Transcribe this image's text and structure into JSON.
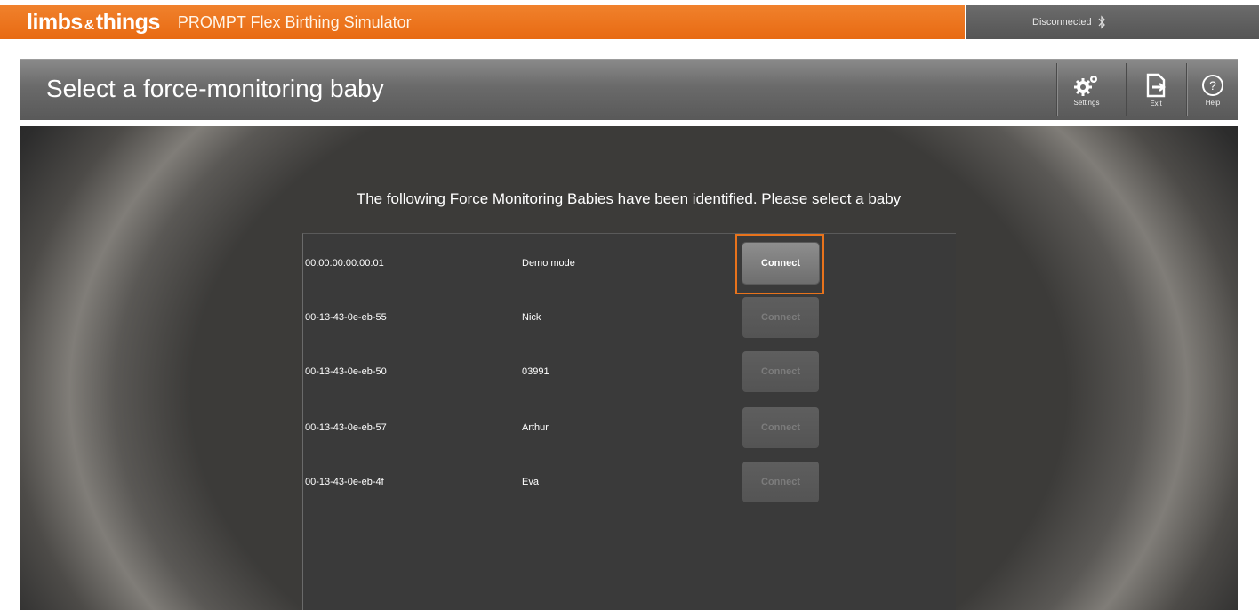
{
  "app": {
    "brand": "limbs&things",
    "brand_main_a": "limbs",
    "brand_amp": "&",
    "brand_main_b": "things",
    "title": "PROMPT Flex Birthing Simulator",
    "connection_status": "Disconnected",
    "status_icon": "bluetooth-icon",
    "brand_color": "#e8731c"
  },
  "header": {
    "title": "Select a force-monitoring baby",
    "tools": [
      {
        "label": "Settings",
        "icon": "gear-icon"
      },
      {
        "label": "Exit",
        "icon": "exit-icon"
      },
      {
        "label": "Help",
        "icon": "help-icon"
      }
    ]
  },
  "main": {
    "instruction": "The following Force Monitoring Babies have been identified. Please select a baby",
    "connect_label": "Connect",
    "devices": [
      {
        "mac": "00:00:00:00:00:01",
        "name": "Demo mode",
        "enabled": true,
        "highlighted": true
      },
      {
        "mac": "00-13-43-0e-eb-55",
        "name": "Nick",
        "enabled": false
      },
      {
        "mac": "00-13-43-0e-eb-50",
        "name": "03991",
        "enabled": false
      },
      {
        "mac": "00-13-43-0e-eb-57",
        "name": "Arthur",
        "enabled": false
      },
      {
        "mac": "00-13-43-0e-eb-4f",
        "name": "Eva",
        "enabled": false
      }
    ]
  }
}
